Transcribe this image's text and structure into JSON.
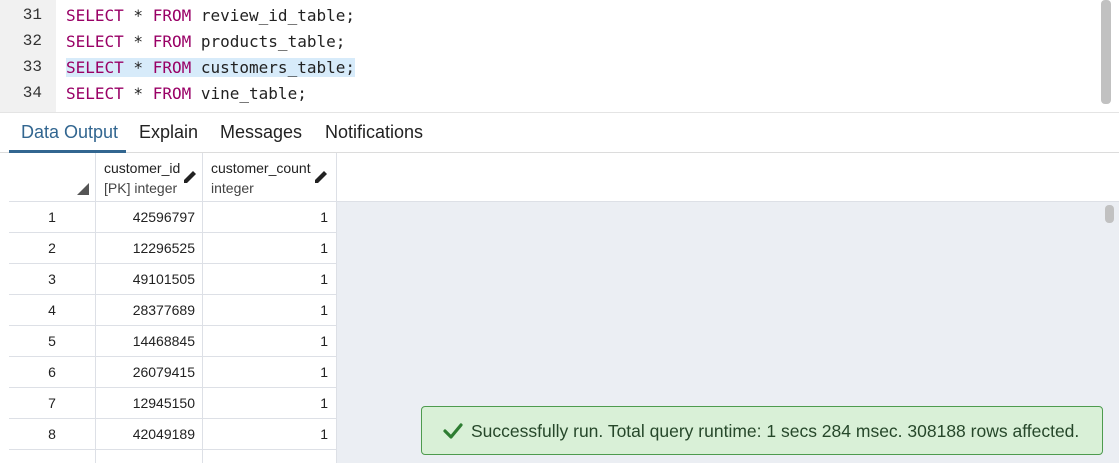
{
  "editor": {
    "lines": [
      {
        "number": "31",
        "keyword1": "SELECT",
        "star": " * ",
        "keyword2": "FROM",
        "rest": " review_id_table;"
      },
      {
        "number": "32",
        "keyword1": "SELECT",
        "star": " * ",
        "keyword2": "FROM",
        "rest": " products_table;"
      },
      {
        "number": "33",
        "keyword1": "SELECT",
        "star": " * ",
        "keyword2": "FROM",
        "rest": " customers_table;"
      },
      {
        "number": "34",
        "keyword1": "SELECT",
        "star": " * ",
        "keyword2": "FROM",
        "rest": " vine_table;"
      }
    ]
  },
  "tabs": [
    {
      "label": "Data Output"
    },
    {
      "label": "Explain"
    },
    {
      "label": "Messages"
    },
    {
      "label": "Notifications"
    }
  ],
  "grid": {
    "columns": [
      {
        "name": "customer_id",
        "type": "[PK] integer"
      },
      {
        "name": "customer_count",
        "type": "integer"
      }
    ],
    "rows": [
      {
        "num": "1",
        "customer_id": "42596797",
        "customer_count": "1"
      },
      {
        "num": "2",
        "customer_id": "12296525",
        "customer_count": "1"
      },
      {
        "num": "3",
        "customer_id": "49101505",
        "customer_count": "1"
      },
      {
        "num": "4",
        "customer_id": "28377689",
        "customer_count": "1"
      },
      {
        "num": "5",
        "customer_id": "14468845",
        "customer_count": "1"
      },
      {
        "num": "6",
        "customer_id": "26079415",
        "customer_count": "1"
      },
      {
        "num": "7",
        "customer_id": "12945150",
        "customer_count": "1"
      },
      {
        "num": "8",
        "customer_id": "42049189",
        "customer_count": "1"
      }
    ]
  },
  "toast": {
    "message": "Successfully run. Total query runtime: 1 secs 284 msec. 308188 rows affected.",
    "icon": "check-icon"
  },
  "colors": {
    "keyword": "#990066",
    "active_tab": "#326690",
    "toast_bg": "#d9f0d7",
    "toast_border": "#4e9b4e"
  }
}
